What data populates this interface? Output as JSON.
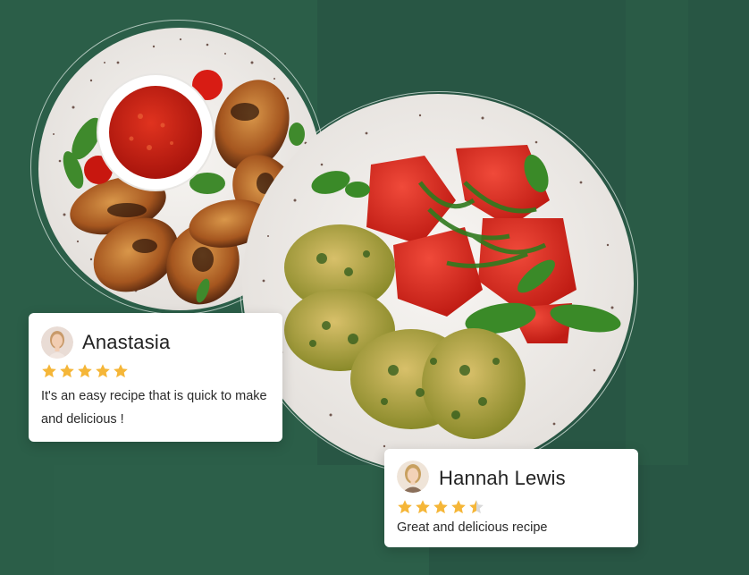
{
  "colors": {
    "background": "#2a5a46",
    "card": "#ffffff",
    "star": "#f5b638",
    "star_empty": "#d9d9d9"
  },
  "reviews": [
    {
      "name": "Anastasia",
      "rating": 5,
      "rating_max": 5,
      "text": "It's an easy recipe that is quick to make and delicious !",
      "avatar_icon": "woman-avatar-icon"
    },
    {
      "name": "Hannah Lewis",
      "rating": 4.5,
      "rating_max": 5,
      "text": "Great and delicious recipe",
      "avatar_icon": "woman-avatar-icon"
    }
  ],
  "images": [
    {
      "icon": "chicken-wings-plate-image"
    },
    {
      "icon": "spinach-fritters-tomato-plate-image"
    }
  ]
}
